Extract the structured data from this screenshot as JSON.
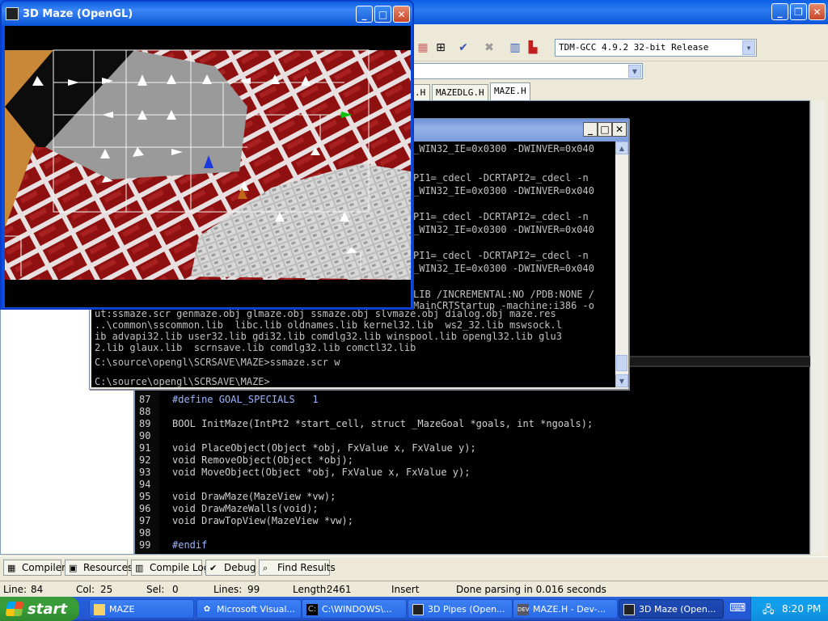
{
  "ide": {
    "compiler_select": "TDM-GCC 4.9.2 32-bit Release",
    "file_tabs": [
      ".H",
      "MAZEDLG.H",
      "MAZE.H"
    ],
    "code_lines": [
      {
        "n": "87",
        "text": "#define GOAL_SPECIALS   1"
      },
      {
        "n": "88",
        "text": ""
      },
      {
        "n": "89",
        "text": "BOOL InitMaze(IntPt2 *start_cell, struct _MazeGoal *goals, int *ngoals);"
      },
      {
        "n": "90",
        "text": ""
      },
      {
        "n": "91",
        "text": "void PlaceObject(Object *obj, FxValue x, FxValue y);"
      },
      {
        "n": "92",
        "text": "void RemoveObject(Object *obj);"
      },
      {
        "n": "93",
        "text": "void MoveObject(Object *obj, FxValue x, FxValue y);"
      },
      {
        "n": "94",
        "text": ""
      },
      {
        "n": "95",
        "text": "void DrawMaze(MazeView *vw);"
      },
      {
        "n": "96",
        "text": "void DrawMazeWalls(void);"
      },
      {
        "n": "97",
        "text": "void DrawTopView(MazeView *vw);"
      },
      {
        "n": "98",
        "text": ""
      },
      {
        "n": "99",
        "text": "#endif"
      }
    ],
    "bottom_tabs": [
      "Compiler",
      "Resources",
      "Compile Log",
      "Debug",
      "Find Results"
    ],
    "status": {
      "line_label": "Line:",
      "line_value": "84",
      "col_label": "Col:",
      "col_value": "25",
      "sel_label": "Sel:",
      "sel_value": "0",
      "lines_label": "Lines:",
      "lines_value": "99",
      "length_label": "Length:",
      "length_value": "2461",
      "mode": "Insert",
      "message": "Done parsing in 0.016 seconds"
    }
  },
  "console": {
    "lines": [
      "_WIN32_IE=0x0300 -DWINVER=0x040",
      "",
      "",
      "PI1=_cdecl -DCRTAPI2=_cdecl -n",
      "_WIN32_IE=0x0300 -DWINVER=0x040",
      "",
      "PI1=_cdecl -DCRTAPI2=_cdecl -n",
      "_WIN32_IE=0x0300 -DWINVER=0x040",
      "",
      "PI1=_cdecl -DCRTAPI2=_cdecl -n",
      "_WIN32_IE=0x0300 -DWINVER=0x040",
      "",
      "LIB /INCREMENTAL:NO /PDB:NONE /",
      "MainCRTStartup -machine:i386 -o",
      "ut:ssmaze.scr genmaze.obj glmaze.obj ssmaze.obj slvmaze.obj dialog.obj maze.res",
      "..\\common\\sscommon.lib  libc.lib oldnames.lib kernel32.lib  ws2_32.lib mswsock.l",
      "ib advapi32.lib user32.lib gdi32.lib comdlg32.lib winspool.lib opengl32.lib glu3",
      "2.lib glaux.lib  scrnsave.lib comdlg32.lib comctl32.lib",
      "",
      "C:\\source\\opengl\\SCRSAVE\\MAZE>ssmaze.scr w",
      "",
      "C:\\source\\opengl\\SCRSAVE\\MAZE>"
    ]
  },
  "maze_window": {
    "title": "3D Maze (OpenGL)"
  },
  "taskbar": {
    "start_label": "start",
    "tasks": [
      "MAZE",
      "Microsoft Visual...",
      "C:\\WINDOWS\\...",
      "3D Pipes (Open...",
      "MAZE.H - Dev-...",
      "3D Maze (Open..."
    ],
    "active_task": "3D Maze (Open...",
    "clock": "8:20 PM"
  },
  "colors": {
    "xp_blue": "#0a55d8",
    "brick_red": "#8e1010",
    "mortar": "#e8e0e0",
    "console_bg": "#000000",
    "console_text": "#c0c0c0"
  }
}
